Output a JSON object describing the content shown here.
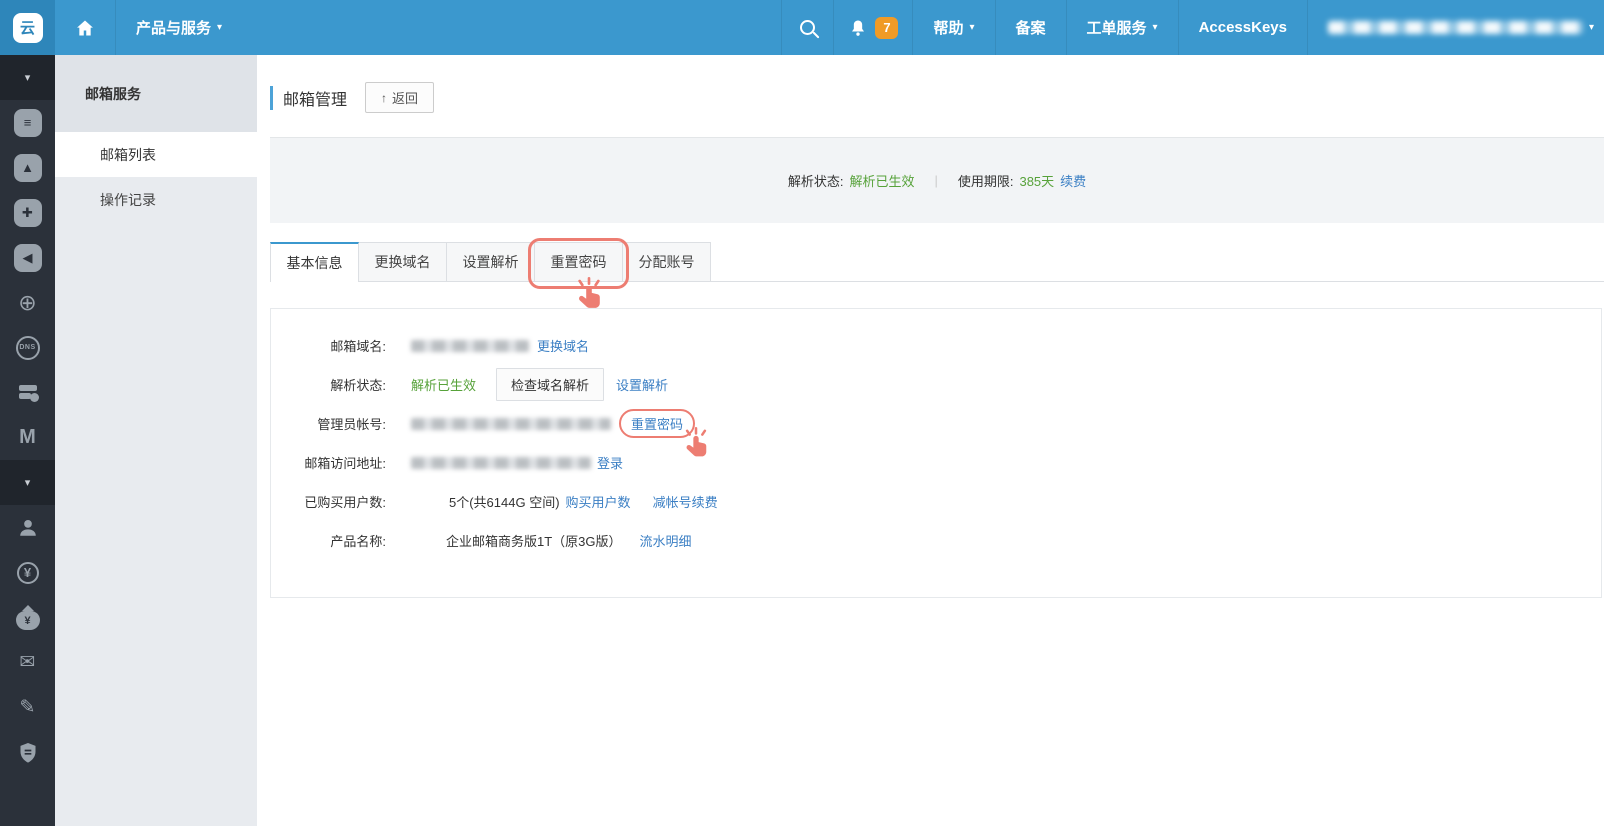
{
  "colors": {
    "topbar_bg": "#3b98ce",
    "topbar_logo_bg": "#2e86ba",
    "rail_bg": "#2b313a",
    "sidebar_bg": "#e8ebef",
    "link_blue": "#3b7fc4",
    "status_green": "#57a23a",
    "annotation_red": "#ed7d72",
    "badge_orange": "#f09b26"
  },
  "icons": {
    "caret": "▾",
    "rail_chevron": "▾",
    "back_arrow": "↑",
    "logo_glyph": "云",
    "console_list": "≡",
    "app_triangle": "▲",
    "node_cross": "✚",
    "announce": "◀",
    "globe": "⊕",
    "dns": "DNS",
    "mail_m": "M",
    "yen": "¥",
    "bag_yen": "¥",
    "envelope": "✉",
    "pencil": "✎"
  },
  "topbar": {
    "products_label": "产品与服务",
    "help_label": "帮助",
    "beian_label": "备案",
    "ticket_label": "工单服务",
    "accesskeys_label": "AccessKeys",
    "notification_count": "7"
  },
  "sidebar": {
    "header": "邮箱服务",
    "items": [
      {
        "label": "邮箱列表",
        "active": true
      },
      {
        "label": "操作记录",
        "active": false
      }
    ]
  },
  "page": {
    "title": "邮箱管理",
    "back_label": "返回",
    "status_bar": {
      "resolution_label": "解析状态:",
      "resolution_value": "解析已生效",
      "separator": "|",
      "period_label": "使用期限:",
      "period_value": "385天",
      "renew_label": "续费"
    },
    "tabs": [
      {
        "label": "基本信息",
        "active": true
      },
      {
        "label": "更换域名",
        "active": false
      },
      {
        "label": "设置解析",
        "active": false
      },
      {
        "label": "重置密码",
        "active": false,
        "annotated": true
      },
      {
        "label": "分配账号",
        "active": false
      }
    ],
    "info": {
      "domain_label": "邮箱域名:",
      "domain_action": "更换域名",
      "resolution_label": "解析状态:",
      "resolution_value": "解析已生效",
      "check_resolution_button": "检查域名解析",
      "set_resolution_link": "设置解析",
      "admin_label": "管理员帐号:",
      "reset_password_link": "重置密码",
      "webmail_label": "邮箱访问地址:",
      "login_link": "登录",
      "users_label": "已购买用户数:",
      "users_value": "5个(共6144G 空间)",
      "buy_users_link": "购买用户数",
      "reduce_renew_link": "减帐号续费",
      "product_label": "产品名称:",
      "product_value": "企业邮箱商务版1T（原3G版）",
      "billing_link": "流水明细"
    }
  }
}
